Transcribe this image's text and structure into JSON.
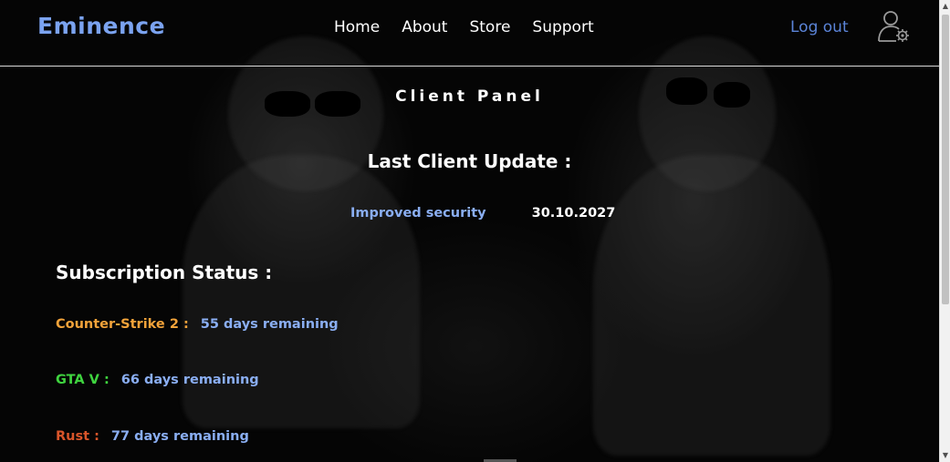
{
  "header": {
    "brand": "Eminence",
    "nav": [
      "Home",
      "About",
      "Store",
      "Support"
    ],
    "logout_label": "Log out",
    "user_icon": "user-settings-icon"
  },
  "main": {
    "panel_title": "Client Panel",
    "last_update": {
      "title": "Last Client Update :",
      "description": "Improved security",
      "date": "30.10.2027"
    },
    "subscription": {
      "title": "Subscription Status :",
      "items": [
        {
          "game": "Counter-Strike 2 :",
          "remaining": "55 days remaining",
          "color": "#f2a33a"
        },
        {
          "game": "GTA V :",
          "remaining": "66 days remaining",
          "color": "#3fd43f"
        },
        {
          "game": "Rust :",
          "remaining": "77 days remaining",
          "color": "#d9552a"
        }
      ]
    }
  },
  "colors": {
    "brand": "#7ba3f0",
    "accent_link": "#5b84d8",
    "remaining": "#8aaef2"
  },
  "scrollbar": {
    "up_icon": "scroll-up-icon",
    "down_icon": "scroll-down-icon"
  }
}
